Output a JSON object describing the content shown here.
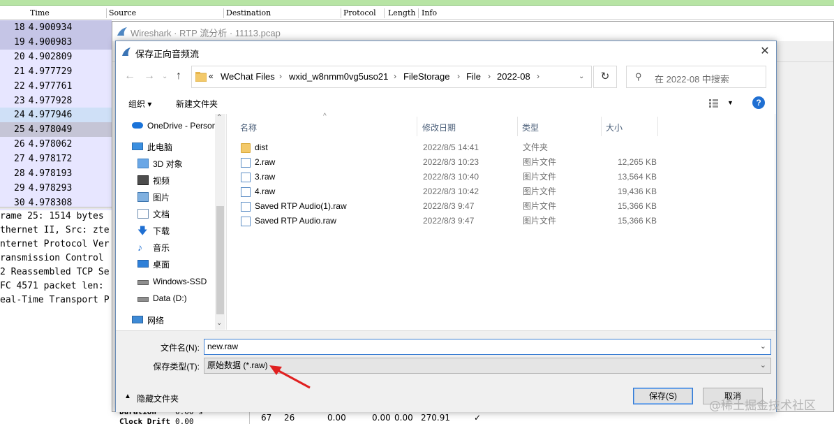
{
  "background": {
    "columns": [
      "Time",
      "Source",
      "Destination",
      "Protocol",
      "Length",
      "Info"
    ],
    "rows": [
      {
        "no": "18",
        "time": "4.900934"
      },
      {
        "no": "19",
        "time": "4.900983"
      },
      {
        "no": "20",
        "time": "4.902809"
      },
      {
        "no": "21",
        "time": "4.977729"
      },
      {
        "no": "22",
        "time": "4.977761"
      },
      {
        "no": "23",
        "time": "4.977928"
      },
      {
        "no": "24",
        "time": "4.977946"
      },
      {
        "no": "25",
        "time": "4.978049"
      },
      {
        "no": "26",
        "time": "4.978062"
      },
      {
        "no": "27",
        "time": "4.978172"
      },
      {
        "no": "28",
        "time": "4.978193"
      },
      {
        "no": "29",
        "time": "4.978293"
      },
      {
        "no": "30",
        "time": "4.978308"
      }
    ],
    "details": [
      "rame 25: 1514 bytes",
      "thernet II, Src: zte",
      "nternet Protocol Ver",
      "ransmission Control",
      "2 Reassembled TCP Se",
      "FC 4571 packet len:",
      "eal-Time Transport P"
    ],
    "bottom_left": [
      "Duration",
      "0.00 s",
      "Clock Drift",
      "0.00"
    ],
    "bottom_right": [
      "67",
      "26",
      "0.00",
      "0.00",
      "0.00",
      "270.91",
      "✓"
    ],
    "rtp_window_title": "Wireshark · RTP 流分析 · 11113.pcap"
  },
  "dialog": {
    "title": "保存正向音频流",
    "close": "✕",
    "breadcrumb": [
      "«",
      "WeChat Files",
      "wxid_w8nmm0vg5uso21",
      "FileStorage",
      "File",
      "2022-08"
    ],
    "search_placeholder": "在 2022-08 中搜索",
    "toolbar": {
      "organize": "组织 ▾",
      "new_folder": "新建文件夹",
      "help": "?"
    },
    "nav": [
      {
        "label": "OneDrive - Persona",
        "icon": "cloud-icon"
      },
      {
        "label": "此电脑",
        "icon": "computer-icon"
      },
      {
        "label": "3D 对象",
        "icon": "cube-icon"
      },
      {
        "label": "视频",
        "icon": "video-icon"
      },
      {
        "label": "图片",
        "icon": "picture-icon"
      },
      {
        "label": "文档",
        "icon": "document-icon"
      },
      {
        "label": "下载",
        "icon": "download-icon"
      },
      {
        "label": "音乐",
        "icon": "music-icon"
      },
      {
        "label": "桌面",
        "icon": "desktop-icon"
      },
      {
        "label": "Windows-SSD",
        "icon": "drive-icon"
      },
      {
        "label": "Data (D:)",
        "icon": "drive-icon"
      },
      {
        "label": "网络",
        "icon": "network-icon"
      }
    ],
    "columns": {
      "name": "名称",
      "date": "修改日期",
      "type": "类型",
      "size": "大小"
    },
    "files": [
      {
        "name": "dist",
        "date": "2022/8/5 14:41",
        "type": "文件夹",
        "size": "",
        "icon": "folder-icon"
      },
      {
        "name": "2.raw",
        "date": "2022/8/3 10:23",
        "type": "图片文件",
        "size": "12,265 KB",
        "icon": "file-icon"
      },
      {
        "name": "3.raw",
        "date": "2022/8/3 10:40",
        "type": "图片文件",
        "size": "13,564 KB",
        "icon": "file-icon"
      },
      {
        "name": "4.raw",
        "date": "2022/8/3 10:42",
        "type": "图片文件",
        "size": "19,436 KB",
        "icon": "file-icon"
      },
      {
        "name": "Saved RTP Audio(1).raw",
        "date": "2022/8/3 9:47",
        "type": "图片文件",
        "size": "15,366 KB",
        "icon": "file-icon"
      },
      {
        "name": "Saved RTP Audio.raw",
        "date": "2022/8/3 9:47",
        "type": "图片文件",
        "size": "15,366 KB",
        "icon": "file-icon"
      }
    ],
    "filename_label": "文件名(N):",
    "filename_value": "new.raw",
    "filetype_label": "保存类型(T):",
    "filetype_value": "原始数据 (*.raw)",
    "hide_folders": "隐藏文件夹",
    "save_label": "保存(S)",
    "cancel_label": "取消"
  },
  "watermark": "@稀土掘金技术社区",
  "colors": {
    "accent": "#1f6fd2",
    "selected_row": "#cce4f7",
    "annotation_arrow": "#e02020"
  }
}
